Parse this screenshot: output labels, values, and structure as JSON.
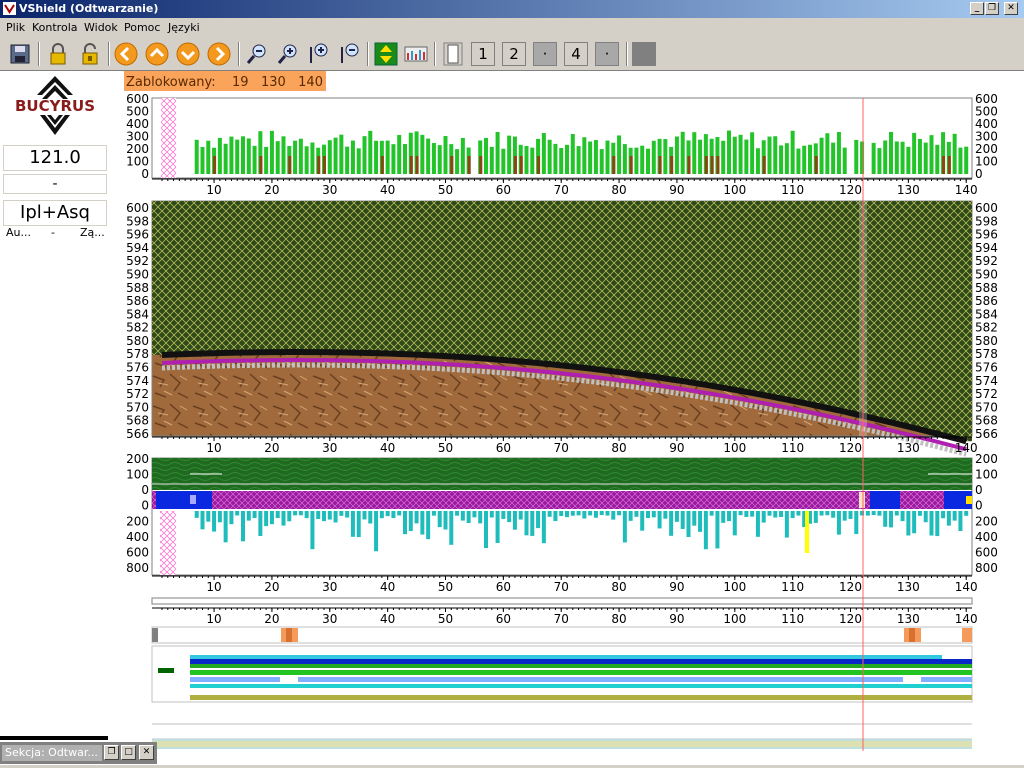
{
  "window": {
    "title": "VShield (Odtwarzanie)"
  },
  "menu": [
    "Plik",
    "Kontrola",
    "Widok",
    "Pomoc",
    "Języki"
  ],
  "toolbar": {
    "page_buttons": [
      "1",
      "2",
      "4"
    ]
  },
  "left_panel": {
    "logo_text": "BUCYRUS",
    "value": "121.0",
    "dash": "-",
    "mode": "Ipl+Asq",
    "row": [
      "Au...",
      "-",
      "Zą..."
    ]
  },
  "blocked": {
    "label": "Zablokowany:",
    "values": "19   130   140"
  },
  "axes": {
    "x_ticks": [
      "10",
      "20",
      "30",
      "40",
      "50",
      "60",
      "70",
      "80",
      "90",
      "100",
      "110",
      "120",
      "130",
      "140"
    ],
    "top_y_ticks": [
      "600",
      "500",
      "400",
      "300",
      "200",
      "100",
      "0"
    ],
    "profile_y_ticks": [
      "600",
      "598",
      "596",
      "594",
      "592",
      "590",
      "588",
      "586",
      "584",
      "582",
      "580",
      "578",
      "576",
      "574",
      "572",
      "570",
      "568",
      "566"
    ],
    "lower_y_ticks": [
      "200",
      "100",
      "0",
      "0",
      "200",
      "400",
      "600",
      "800"
    ]
  },
  "status": {
    "section_title": "Sekcja: Odtwar..."
  },
  "colors": {
    "accent_blocked": "#f9a35b",
    "bar_green": "#22c42a",
    "profile_magenta": "#b020b0",
    "cyan_bars": "#1fbcbc"
  }
}
